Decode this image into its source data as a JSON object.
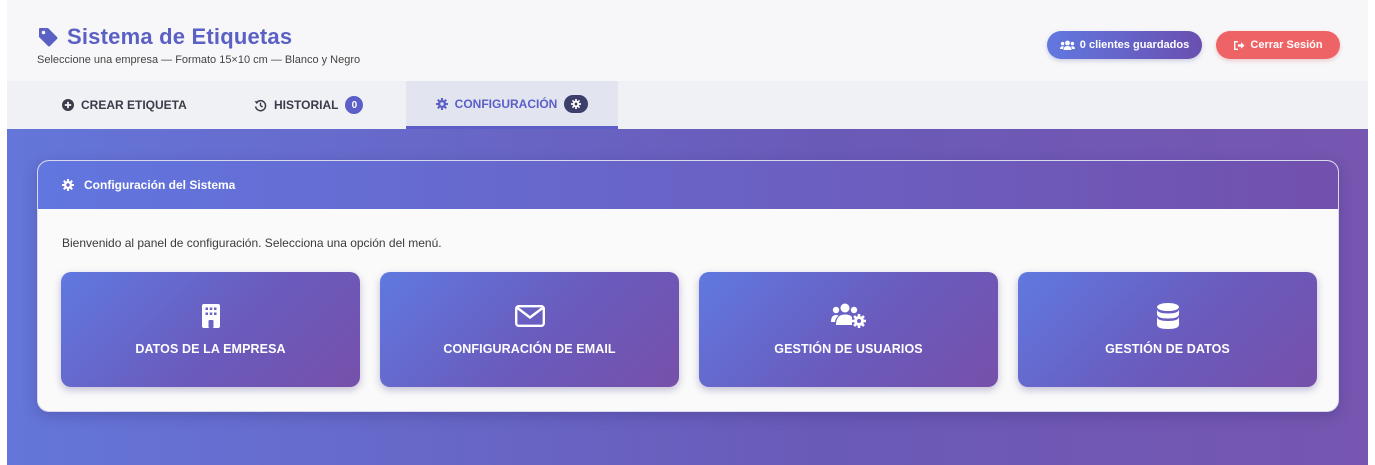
{
  "header": {
    "title": "Sistema de Etiquetas",
    "subtitle": "Seleccione una empresa — Formato 15×10 cm — Blanco y Negro",
    "clients_button": "0 clientes guardados",
    "logout_button": "Cerrar Sesión"
  },
  "tabs": [
    {
      "label": "CREAR ETIQUETA"
    },
    {
      "label": "HISTORIAL",
      "badge": "0"
    },
    {
      "label": "CONFIGURACIÓN",
      "active": true
    }
  ],
  "panel": {
    "title": "Configuración del Sistema",
    "intro": "Bienvenido al panel de configuración. Selecciona una opción del menú.",
    "tiles": [
      {
        "label": "DATOS DE LA EMPRESA",
        "icon": "building-icon"
      },
      {
        "label": "CONFIGURACIÓN DE EMAIL",
        "icon": "envelope-icon"
      },
      {
        "label": "GESTIÓN DE USUARIOS",
        "icon": "users-cog-icon"
      },
      {
        "label": "GESTIÓN DE DATOS",
        "icon": "database-icon"
      }
    ]
  },
  "colors": {
    "brand": "#5b60c4",
    "accent": "#5b5fc7",
    "logout": "#ee6466",
    "gradient_start": "#6176df",
    "gradient_end": "#7250ad"
  }
}
